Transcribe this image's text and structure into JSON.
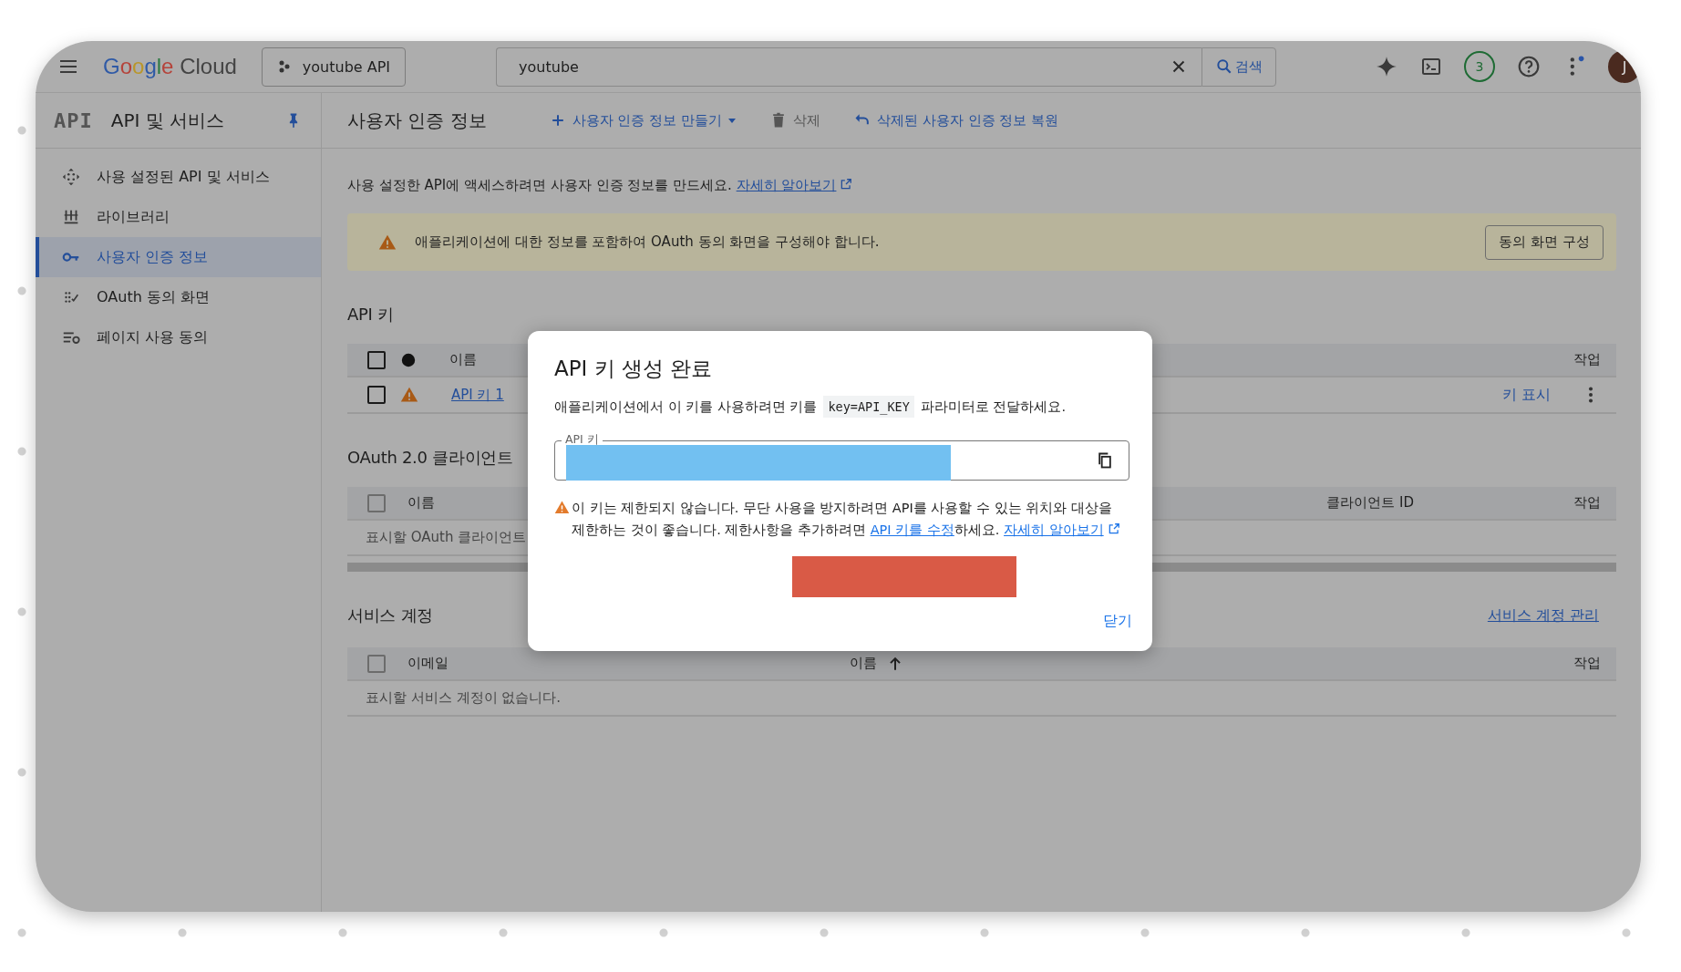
{
  "topbar": {
    "logo_first": "Google",
    "logo_second": "Cloud",
    "project": "youtube API",
    "search": {
      "value": "youtube"
    },
    "search_button": "검색",
    "badge": "3",
    "avatar": "J"
  },
  "sidebar": {
    "logo": "API",
    "title": "API 및 서비스",
    "items": [
      {
        "label": "사용 설정된 API 및 서비스",
        "kind": "apis",
        "selected": false
      },
      {
        "label": "라이브러리",
        "kind": "library",
        "selected": false
      },
      {
        "label": "사용자 인증 정보",
        "kind": "key",
        "selected": true
      },
      {
        "label": "OAuth 동의 화면",
        "kind": "consent",
        "selected": false
      },
      {
        "label": "페이지 사용 동의",
        "kind": "settings",
        "selected": false
      }
    ]
  },
  "header": {
    "title": "사용자 인증 정보",
    "actions": [
      {
        "label": "사용자 인증 정보 만들기",
        "kind": "create",
        "disabled": false
      },
      {
        "label": "삭제",
        "kind": "delete",
        "disabled": true
      },
      {
        "label": "삭제된 사용자 인증 정보 복원",
        "kind": "restore",
        "disabled": false
      }
    ]
  },
  "intro": {
    "text": "사용 설정한 API에 액세스하려면 사용자 인증 정보를 만드세요.",
    "link": "자세히 알아보기"
  },
  "banner": {
    "text": "애플리케이션에 대한 정보를 포함하여 OAuth 동의 화면을 구성해야 합니다.",
    "button": "동의 화면 구성"
  },
  "api_keys": {
    "title": "API 키",
    "select_all_checked": false,
    "columns": [
      "이름",
      "작업"
    ],
    "rows": [
      {
        "name": "API 키 1",
        "checked": false,
        "action": "키 표시"
      }
    ]
  },
  "oauth": {
    "title": "OAuth 2.0 클라이언트",
    "select_all_checked": false,
    "columns": [
      "이름",
      "클라이언트 ID",
      "작업"
    ],
    "empty": "표시할 OAuth 클라이언트"
  },
  "service_accounts": {
    "title": "서비스 계정",
    "link": "서비스 계정 관리",
    "select_all_checked": false,
    "columns": [
      "이메일",
      "이름",
      "작업"
    ],
    "empty": "표시할 서비스 계정이 없습니다."
  },
  "dialog": {
    "title": "API 키 생성 완료",
    "desc_before": "애플리케이션에서 이 키를 사용하려면 키를",
    "code": "key=API_KEY",
    "desc_after": "파라미터로 전달하세요.",
    "field_label": "API 키",
    "warning_before": "이 키는 제한되지 않습니다. 무단 사용을 방지하려면 API를 사용할 수 있는 위치와 대상을 제한하는 것이 좋습니다. 제한사항을 추가하려면",
    "warning_link": "API 키를 수정",
    "warning_middle": "하세요.",
    "warning_link2": "자세히 알아보기",
    "close": "닫기"
  }
}
